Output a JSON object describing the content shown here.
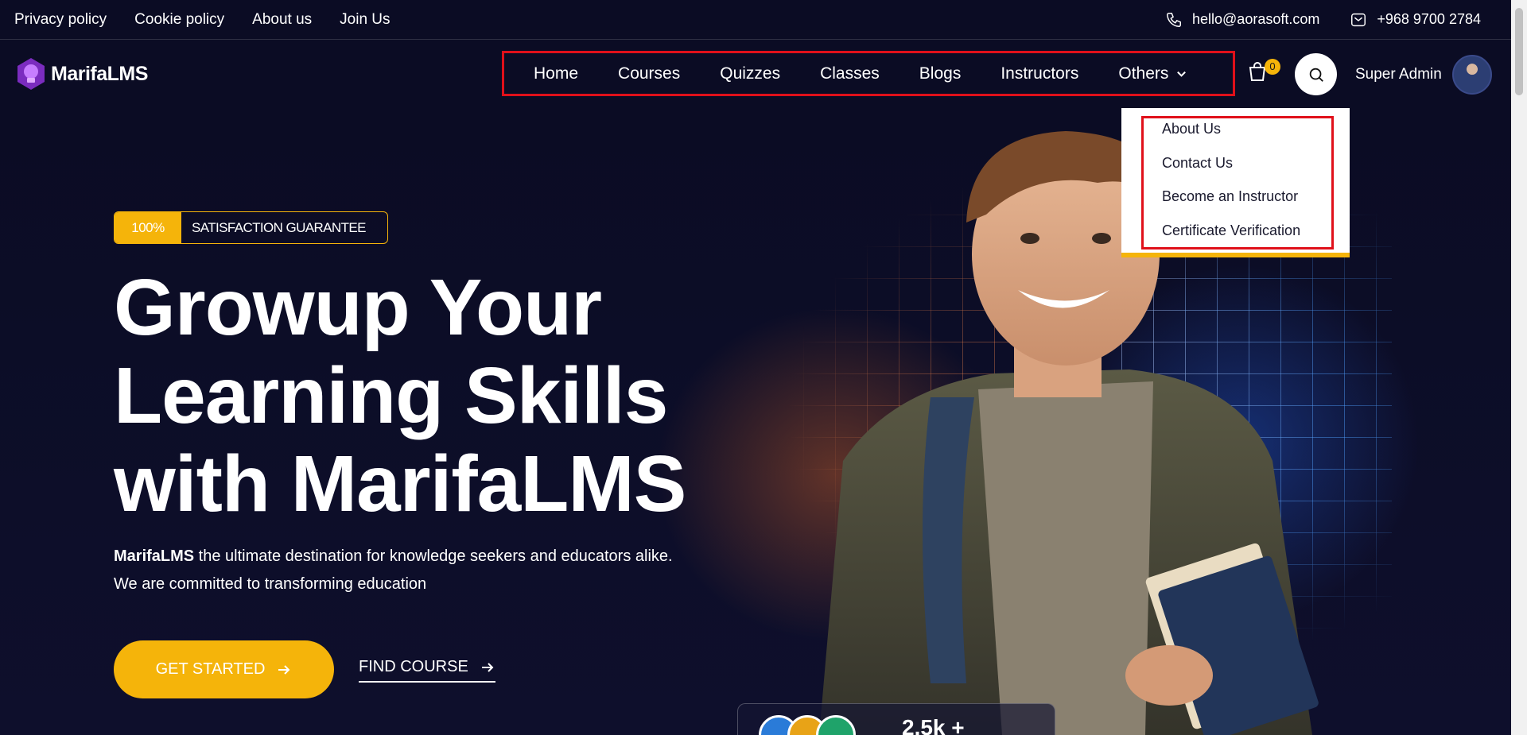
{
  "topbar": {
    "links": [
      "Privacy policy",
      "Cookie policy",
      "About us",
      "Join Us"
    ],
    "email": "hello@aorasoft.com",
    "phone": "+968 9700 2784"
  },
  "header": {
    "logo_text": "MarifaLMS",
    "nav": [
      "Home",
      "Courses",
      "Quizzes",
      "Classes",
      "Blogs",
      "Instructors"
    ],
    "others_label": "Others",
    "cart_count": "0",
    "user_name": "Super Admin"
  },
  "dropdown": {
    "items": [
      "About Us",
      "Contact Us",
      "Become an Instructor",
      "Certificate Verification"
    ]
  },
  "hero": {
    "badge_pct": "100%",
    "badge_text": "SATISFACTION GUARANTEE",
    "headline_line1": "Growup Your",
    "headline_line2": "Learning Skills",
    "headline_line3": "with MarifaLMS",
    "desc_brand": "MarifaLMS",
    "desc_text": " the ultimate destination for knowledge seekers and educators alike. We are committed to transforming education",
    "cta_primary": "GET STARTED",
    "cta_secondary": "FIND COURSE",
    "stats_count": "2.5k +"
  },
  "colors": {
    "accent": "#f5b40a",
    "background": "#0b0c24",
    "highlight_frame": "#e0101a"
  }
}
